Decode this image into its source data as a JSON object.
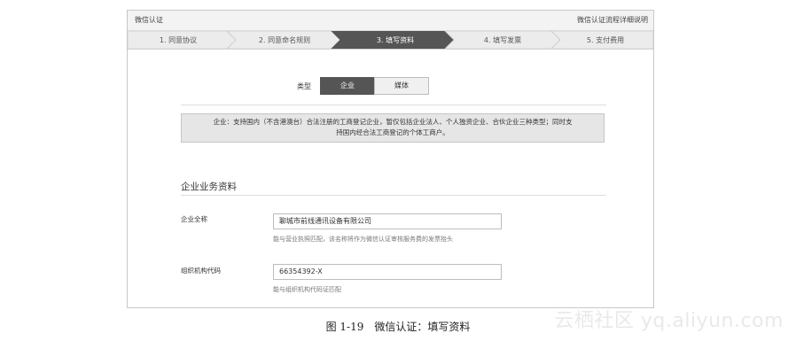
{
  "panel": {
    "title": "微信认证",
    "help_link": "微信认证流程详细说明"
  },
  "steps": [
    {
      "label": "1. 同意协议",
      "active": false
    },
    {
      "label": "2. 同意命名规则",
      "active": false
    },
    {
      "label": "3. 填写资料",
      "active": true
    },
    {
      "label": "4. 填写发票",
      "active": false
    },
    {
      "label": "5. 支付费用",
      "active": false
    }
  ],
  "colors": {
    "step_active": "#555555",
    "step_inactive": "#ececec",
    "notice_bg": "#e6e6e6"
  },
  "type_selector": {
    "label": "类型",
    "options": [
      "企业",
      "媒体"
    ],
    "selected": "企业"
  },
  "notice": {
    "line1": "企业：支持国内（不含港澳台）合法注册的工商登记企业，暂仅包括企业法人、个人独资企业、合伙企业三种类型；同时支",
    "line2": "持国内经合法工商登记的个体工商户。"
  },
  "section": {
    "title": "企业业务资料"
  },
  "fields": [
    {
      "label": "企业全称",
      "value": "聊城市前线通讯设备有限公司",
      "hint": "能与营业执照匹配，该名称将作为微信认证审核服务费的发票抬头"
    },
    {
      "label": "组织机构代码",
      "value": "66354392-X",
      "hint": "能与组织机构代码证匹配"
    }
  ],
  "caption": "图 1-19　微信认证：填写资料",
  "watermark": "云栖社区 yq.aliyun.com"
}
